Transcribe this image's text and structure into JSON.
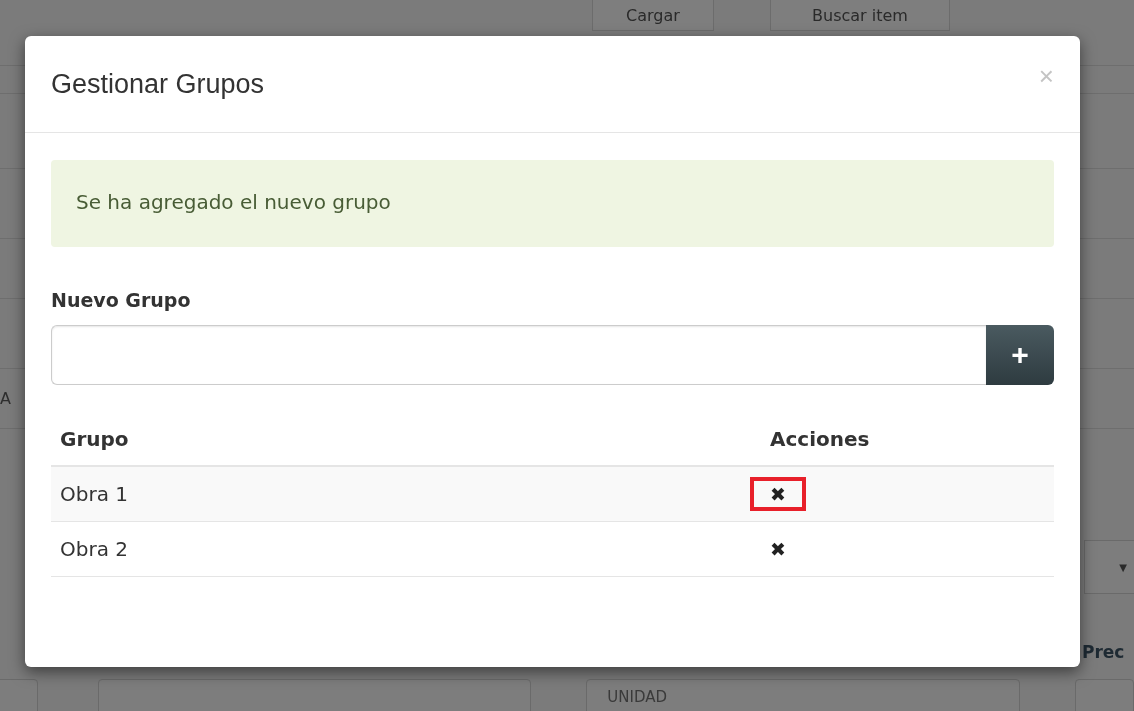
{
  "background": {
    "buttons": [
      "Cargar",
      "Buscar item"
    ],
    "cut_letter": "A",
    "column_label": "Prec",
    "select_caret": "▼",
    "fields": [
      {
        "kind": "input"
      },
      {
        "kind": "input"
      },
      {
        "kind": "input",
        "value": "UNIDAD"
      },
      {
        "kind": "input"
      }
    ]
  },
  "modal": {
    "title": "Gestionar Grupos",
    "close": "×",
    "alert": "Se ha agregado el nuevo grupo",
    "field_label": "Nuevo Grupo",
    "field": {
      "add_button": "+"
    },
    "table": {
      "columns": [
        "Grupo",
        "Acciones"
      ],
      "rows": [
        {
          "name": "Obra 1",
          "delete": "✖",
          "highlighted": true
        },
        {
          "name": "Obra 2",
          "delete": "✖",
          "highlighted": false
        }
      ]
    }
  }
}
